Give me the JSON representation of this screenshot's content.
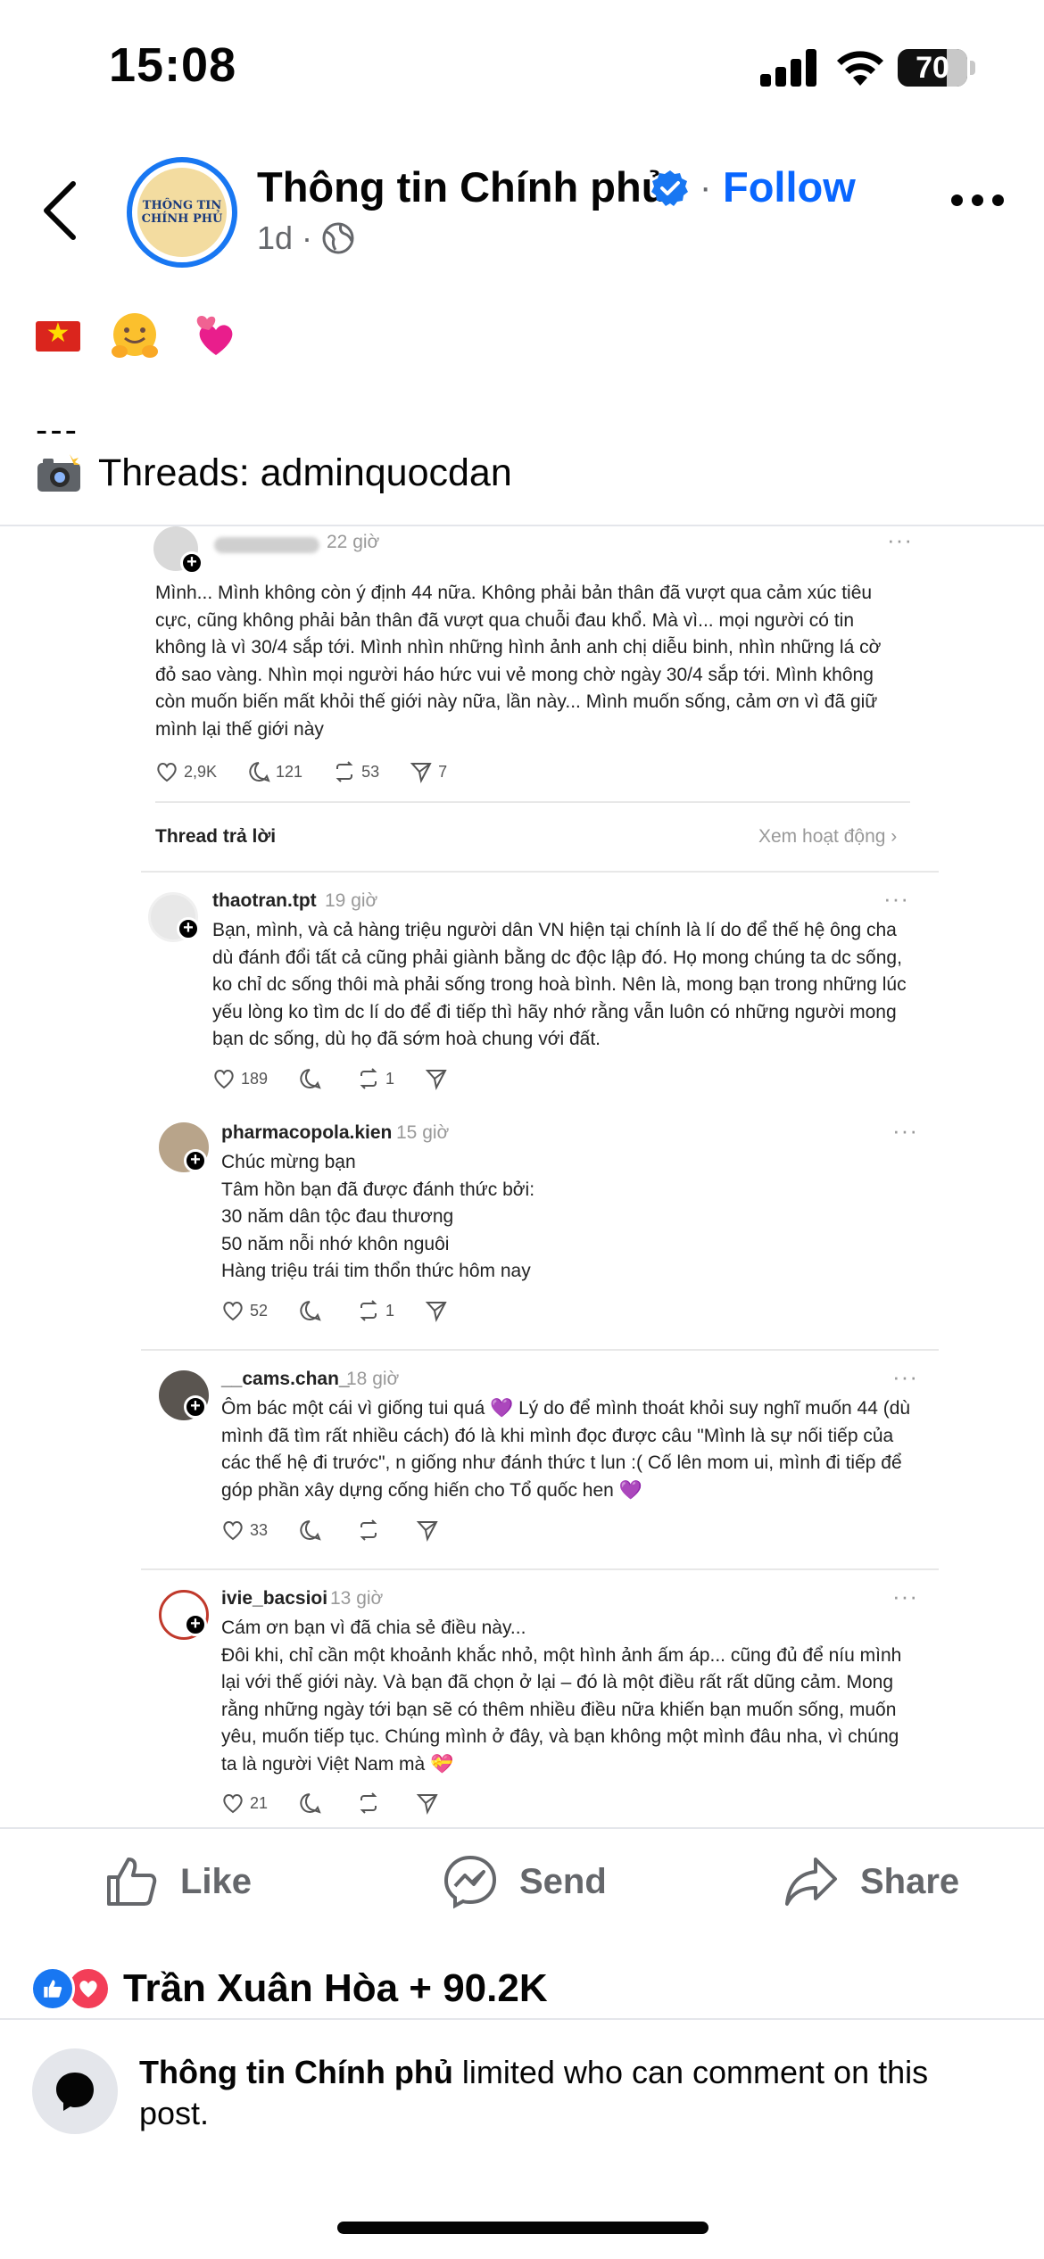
{
  "status_bar": {
    "time": "15:08",
    "battery": "70",
    "battery_level": 0.7
  },
  "post": {
    "page_name": "Thông tin Chính phủ",
    "avatar_line1": "THÔNG TIN",
    "avatar_line2": "CHÍNH PHỦ",
    "follow_label": "Follow",
    "separator": "·",
    "time": "1d ·",
    "dashes": "---",
    "threads_text": "Threads: adminquocdan"
  },
  "screenshot": {
    "original": {
      "time": "22 giờ",
      "dots": "···",
      "text": "Mình... Mình không còn ý định 44 nữa. Không phải bản thân đã vượt qua cảm xúc tiêu cực, cũng không phải bản thân đã vượt qua chuỗi đau khổ. Mà vì... mọi người có tin không là vì 30/4 sắp tới. Mình nhìn những hình ảnh anh chị diễu binh, nhìn những lá cờ đỏ sao vàng. Nhìn mọi người háo hức vui vẻ mong chờ ngày 30/4 sắp tới. Mình không còn muốn biến mất khỏi thế giới này nữa, lần này... Mình muốn sống, cảm ơn vì đã giữ mình lại thế giới này",
      "likes": "2,9K",
      "comments": "121",
      "reposts": "53",
      "shares": "7"
    },
    "thread_reply_label": "Thread trả lời",
    "see_activity": "Xem hoạt động ›",
    "replies": [
      {
        "user": "thaotran.tpt",
        "time": "19 giờ",
        "text": "Bạn, mình, và cả hàng triệu người dân VN hiện tại chính là lí do để thế hệ ông cha dù đánh đổi tất cả cũng phải giành bằng dc độc lập đó. Họ mong chúng ta dc sống, ko chỉ dc sống thôi mà phải sống trong hoà bình. Nên là, mong bạn trong những lúc yếu lòng ko tìm dc lí do để đi tiếp thì hãy nhớ rằng vẫn luôn có những người mong bạn dc sống, dù họ đã sớm hoà chung với đất.",
        "likes": "189",
        "comments": "",
        "reposts": "1"
      },
      {
        "user": "pharmacopola.kien",
        "time": "15 giờ",
        "text": "Chúc mừng bạn\nTâm hồn bạn đã được đánh thức bởi:\n30 năm dân tộc đau thương\n50 năm nỗi nhớ khôn nguôi\nHàng triệu trái tim thổn thức hôm nay",
        "likes": "52",
        "comments": "",
        "reposts": "1"
      },
      {
        "user": "__cams.chan_",
        "time": "18 giờ",
        "text": "Ôm bác một cái vì giống tui quá 💜 Lý do để mình thoát khỏi suy nghĩ muốn 44 (dù mình đã tìm rất nhiều cách) đó là khi mình đọc được câu \"Mình là sự nối tiếp của các thế hệ đi trước\", n giống như đánh thức t lun :( Cố lên mom ui, mình đi tiếp để góp phần xây dựng cống hiến cho Tổ quốc hen 💜",
        "likes": "33",
        "comments": "",
        "reposts": ""
      },
      {
        "user": "ivie_bacsioi",
        "time": "13 giờ",
        "text": "Cám ơn bạn vì đã chia sẻ điều này...\nĐôi khi, chỉ cần một khoảnh khắc nhỏ, một hình ảnh ấm áp... cũng đủ để níu mình lại với thế giới này. Và bạn đã chọn ở lại – đó là một điều rất rất dũng cảm. Mong rằng những ngày tới bạn sẽ có thêm nhiều điều nữa khiến bạn muốn sống, muốn yêu, muốn tiếp tục. Chúng mình ở đây, và bạn không một mình đâu nha, vì chúng ta là người Việt Nam mà 💝",
        "likes": "21",
        "comments": "",
        "reposts": ""
      }
    ]
  },
  "actions": {
    "like": "Like",
    "send": "Send",
    "share": "Share"
  },
  "reactions": {
    "text": "Trần Xuân Hòa + 90.2K"
  },
  "comment_notice": {
    "page_name": "Thông tin Chính phủ",
    "message": " limited who can comment on this post."
  },
  "colors": {
    "accent": "#0866ff",
    "like_blue": "#1877f2",
    "love_red": "#f33e58",
    "secondary_text": "#65676b"
  }
}
